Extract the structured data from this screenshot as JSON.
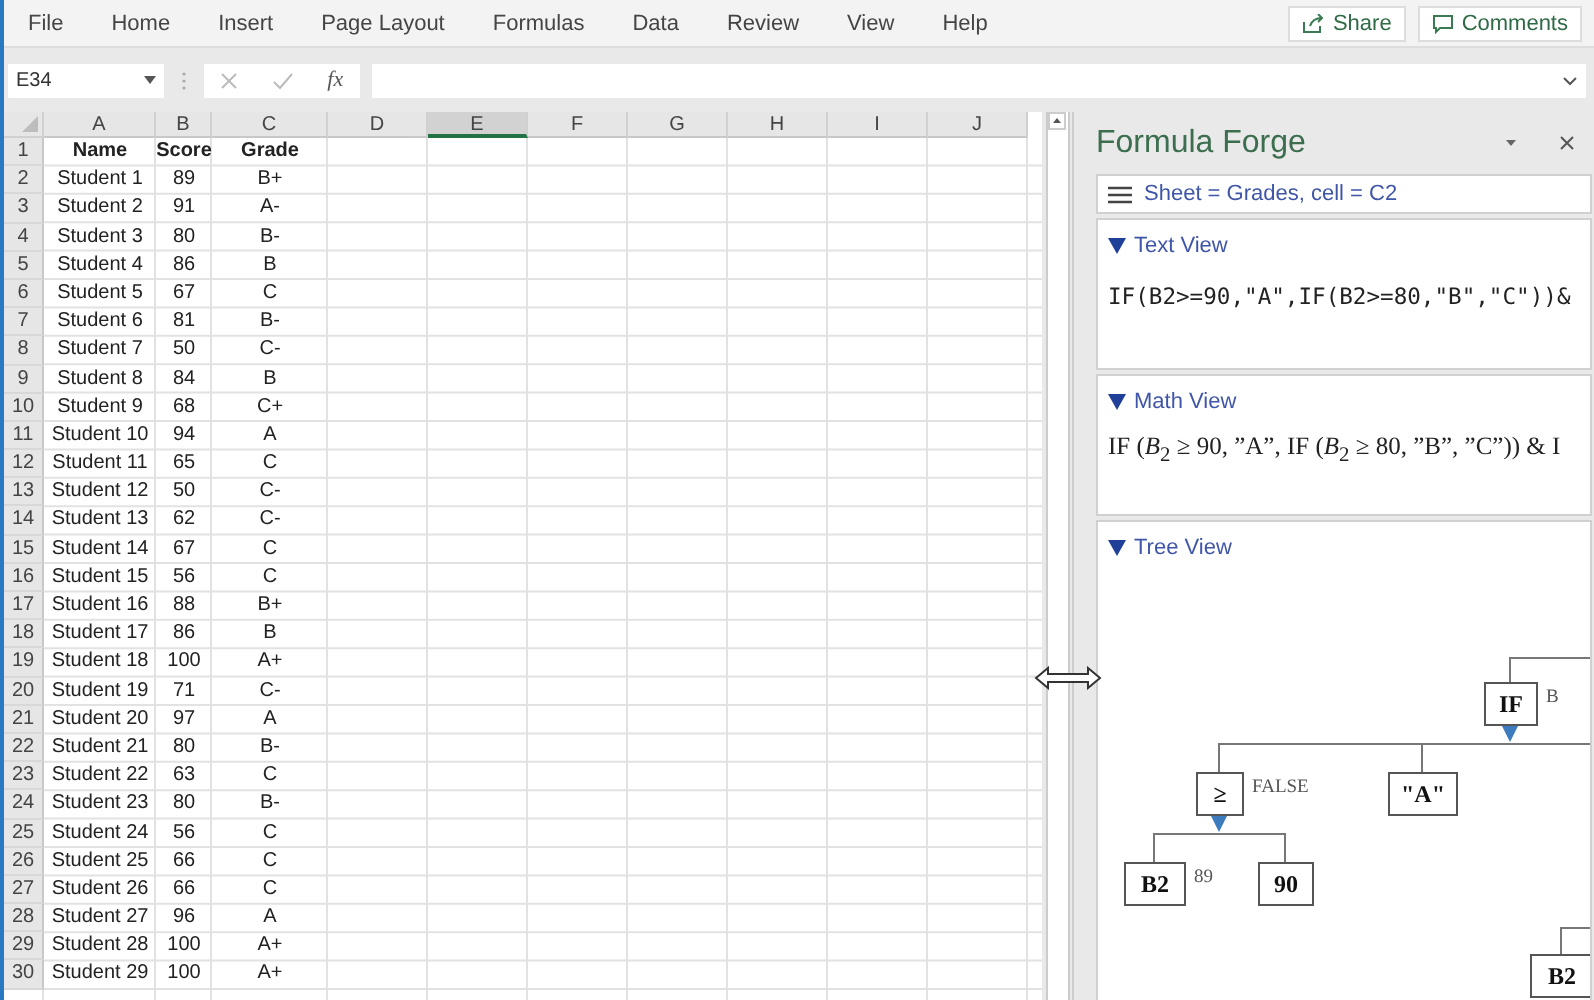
{
  "menu": [
    {
      "label": "File"
    },
    {
      "label": "Home"
    },
    {
      "label": "Insert"
    },
    {
      "label": "Page Layout"
    },
    {
      "label": "Formulas"
    },
    {
      "label": "Data"
    },
    {
      "label": "Review"
    },
    {
      "label": "View"
    },
    {
      "label": "Help"
    }
  ],
  "actions": [
    {
      "kind": "share",
      "label": "Share"
    },
    {
      "kind": "comments",
      "label": "Comments"
    }
  ],
  "formula_bar": {
    "name_box": "E34",
    "fx": "fx"
  },
  "columns": [
    {
      "label": "A",
      "selected": false
    },
    {
      "label": "B",
      "selected": false
    },
    {
      "label": "C",
      "selected": false
    },
    {
      "label": "D",
      "selected": false
    },
    {
      "label": "E",
      "selected": true
    },
    {
      "label": "F",
      "selected": false
    },
    {
      "label": "G",
      "selected": false
    },
    {
      "label": "H",
      "selected": false
    },
    {
      "label": "I",
      "selected": false
    },
    {
      "label": "J",
      "selected": false
    }
  ],
  "rows": [
    {
      "number": "1",
      "bold": true,
      "cells": [
        "Name",
        "Score",
        "Grade"
      ]
    },
    {
      "number": "2",
      "bold": false,
      "cells": [
        "Student 1",
        "89",
        "B+"
      ]
    },
    {
      "number": "3",
      "bold": false,
      "cells": [
        "Student 2",
        "91",
        "A-"
      ]
    },
    {
      "number": "4",
      "bold": false,
      "cells": [
        "Student 3",
        "80",
        "B-"
      ]
    },
    {
      "number": "5",
      "bold": false,
      "cells": [
        "Student 4",
        "86",
        "B"
      ]
    },
    {
      "number": "6",
      "bold": false,
      "cells": [
        "Student 5",
        "67",
        "C"
      ]
    },
    {
      "number": "7",
      "bold": false,
      "cells": [
        "Student 6",
        "81",
        "B-"
      ]
    },
    {
      "number": "8",
      "bold": false,
      "cells": [
        "Student 7",
        "50",
        "C-"
      ]
    },
    {
      "number": "9",
      "bold": false,
      "cells": [
        "Student 8",
        "84",
        "B"
      ]
    },
    {
      "number": "10",
      "bold": false,
      "cells": [
        "Student 9",
        "68",
        "C+"
      ]
    },
    {
      "number": "11",
      "bold": false,
      "cells": [
        "Student 10",
        "94",
        "A"
      ]
    },
    {
      "number": "12",
      "bold": false,
      "cells": [
        "Student 11",
        "65",
        "C"
      ]
    },
    {
      "number": "13",
      "bold": false,
      "cells": [
        "Student 12",
        "50",
        "C-"
      ]
    },
    {
      "number": "14",
      "bold": false,
      "cells": [
        "Student 13",
        "62",
        "C-"
      ]
    },
    {
      "number": "15",
      "bold": false,
      "cells": [
        "Student 14",
        "67",
        "C"
      ]
    },
    {
      "number": "16",
      "bold": false,
      "cells": [
        "Student 15",
        "56",
        "C"
      ]
    },
    {
      "number": "17",
      "bold": false,
      "cells": [
        "Student 16",
        "88",
        "B+"
      ]
    },
    {
      "number": "18",
      "bold": false,
      "cells": [
        "Student 17",
        "86",
        "B"
      ]
    },
    {
      "number": "19",
      "bold": false,
      "cells": [
        "Student 18",
        "100",
        "A+"
      ]
    },
    {
      "number": "20",
      "bold": false,
      "cells": [
        "Student 19",
        "71",
        "C-"
      ]
    },
    {
      "number": "21",
      "bold": false,
      "cells": [
        "Student 20",
        "97",
        "A"
      ]
    },
    {
      "number": "22",
      "bold": false,
      "cells": [
        "Student 21",
        "80",
        "B-"
      ]
    },
    {
      "number": "23",
      "bold": false,
      "cells": [
        "Student 22",
        "63",
        "C"
      ]
    },
    {
      "number": "24",
      "bold": false,
      "cells": [
        "Student 23",
        "80",
        "B-"
      ]
    },
    {
      "number": "25",
      "bold": false,
      "cells": [
        "Student 24",
        "56",
        "C"
      ]
    },
    {
      "number": "26",
      "bold": false,
      "cells": [
        "Student 25",
        "66",
        "C"
      ]
    },
    {
      "number": "27",
      "bold": false,
      "cells": [
        "Student 26",
        "66",
        "C"
      ]
    },
    {
      "number": "28",
      "bold": false,
      "cells": [
        "Student 27",
        "96",
        "A"
      ]
    },
    {
      "number": "29",
      "bold": false,
      "cells": [
        "Student 28",
        "100",
        "A+"
      ]
    },
    {
      "number": "30",
      "bold": false,
      "cells": [
        "Student 29",
        "100",
        "A+"
      ]
    }
  ],
  "pane": {
    "title": "Formula Forge",
    "context": "Sheet = Grades, cell = C2",
    "sections": [
      {
        "kind": "text",
        "title": "Text View",
        "expanded": true,
        "content": "IF(B2>=90,\"A\",IF(B2>=80,\"B\",\"C\"))&"
      },
      {
        "kind": "math",
        "title": "Math View",
        "expanded": true,
        "content": "IF (*B*$_{2}$ ≥ 90, ”A”, IF (*B*$_{2}$ ≥ 80, ”B”, ”C”)) & I"
      },
      {
        "kind": "tree",
        "title": "Tree View",
        "expanded": true
      }
    ],
    "tree": {
      "label": "IF",
      "value": "B",
      "children": [
        {
          "label": "≥",
          "value": "FALSE",
          "children": [
            {
              "label": "B2",
              "value": "89"
            },
            {
              "label": "90"
            }
          ]
        },
        {
          "label": "\"A\""
        }
      ]
    },
    "tree_fragment": {
      "label": "B2"
    }
  }
}
